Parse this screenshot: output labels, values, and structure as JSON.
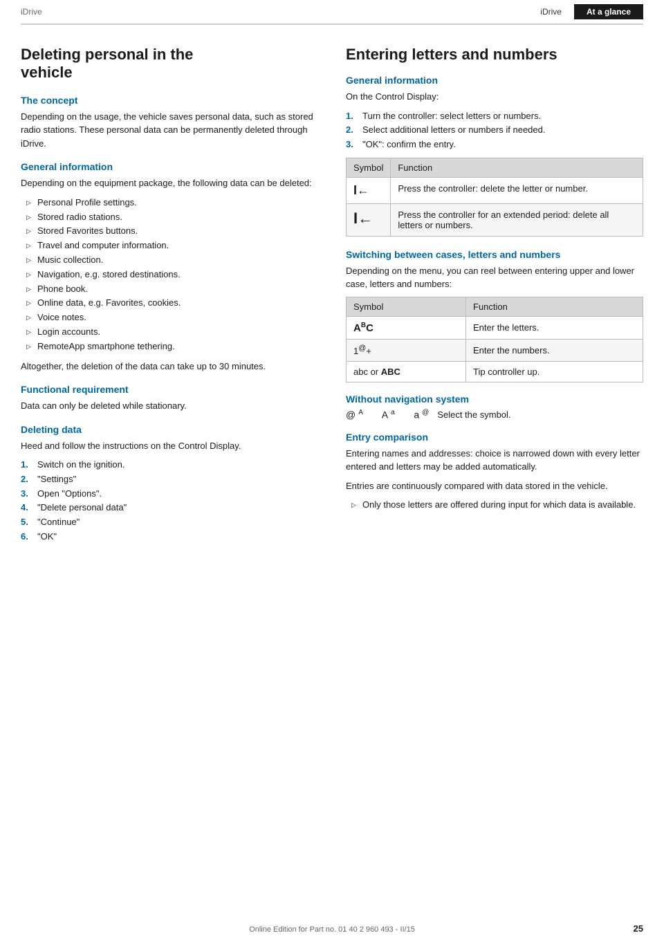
{
  "header": {
    "brand": "iDrive",
    "tab_inactive": "iDrive",
    "tab_active": "At a glance"
  },
  "left": {
    "page_title_line1": "Deleting personal in the",
    "page_title_line2": "vehicle",
    "section1_heading": "The concept",
    "section1_body": "Depending on the usage, the vehicle saves personal data, such as stored radio stations. These personal data can be permanently deleted through iDrive.",
    "section2_heading": "General information",
    "section2_body": "Depending on the equipment package, the following data can be deleted:",
    "bullet_items": [
      "Personal Profile settings.",
      "Stored radio stations.",
      "Stored Favorites buttons.",
      "Travel and computer information.",
      "Music collection.",
      "Navigation, e.g. stored destinations.",
      "Phone book.",
      "Online data, e.g. Favorites, cookies.",
      "Voice notes.",
      "Login accounts.",
      "RemoteApp smartphone tethering."
    ],
    "section2_footer": "Altogether, the deletion of the data can take up to 30 minutes.",
    "section3_heading": "Functional requirement",
    "section3_body": "Data can only be deleted while stationary.",
    "section4_heading": "Deleting data",
    "section4_body": "Heed and follow the instructions on the Control Display.",
    "steps": [
      {
        "num": "1.",
        "text": "Switch on the ignition."
      },
      {
        "num": "2.",
        "text": "\"Settings\""
      },
      {
        "num": "3.",
        "text": "Open \"Options\"."
      },
      {
        "num": "4.",
        "text": "\"Delete personal data\""
      },
      {
        "num": "5.",
        "text": "\"Continue\""
      },
      {
        "num": "6.",
        "text": "\"OK\""
      }
    ]
  },
  "right": {
    "main_title": "Entering letters and numbers",
    "section1_heading": "General information",
    "section1_intro": "On the Control Display:",
    "steps": [
      {
        "num": "1.",
        "text": "Turn the controller: select letters or numbers."
      },
      {
        "num": "2.",
        "text": "Select additional letters or numbers if needed."
      },
      {
        "num": "3.",
        "text": "\"OK\": confirm the entry."
      }
    ],
    "table1": {
      "col1": "Symbol",
      "col2": "Function",
      "rows": [
        {
          "symbol": "I←",
          "function": "Press the controller: delete the letter or number."
        },
        {
          "symbol": "I←",
          "function": "Press the controller for an extended period: delete all letters or numbers."
        }
      ]
    },
    "section2_heading": "Switching between cases, letters and numbers",
    "section2_body": "Depending on the menu, you can reel between entering upper and lower case, letters and numbers:",
    "table2": {
      "col1": "Symbol",
      "col2": "Function",
      "rows": [
        {
          "symbol": "Aᴬc",
          "function": "Enter the letters."
        },
        {
          "symbol": "1@+",
          "function": "Enter the numbers."
        },
        {
          "symbol": "abc or ABC",
          "function": "Tip controller up."
        }
      ]
    },
    "section3_heading": "Without navigation system",
    "section3_symbols": "@ᴬ   Aᵃ   aᵉ",
    "section3_text": "Select the symbol.",
    "section4_heading": "Entry comparison",
    "section4_body1": "Entering names and addresses: choice is narrowed down with every letter entered and letters may be added automatically.",
    "section4_body2": "Entries are continuously compared with data stored in the vehicle.",
    "section4_bullet": "Only those letters are offered during input for which data is available."
  },
  "footer": {
    "text": "Online Edition for Part no. 01 40 2 960 493 - II/15",
    "page_number": "25"
  }
}
